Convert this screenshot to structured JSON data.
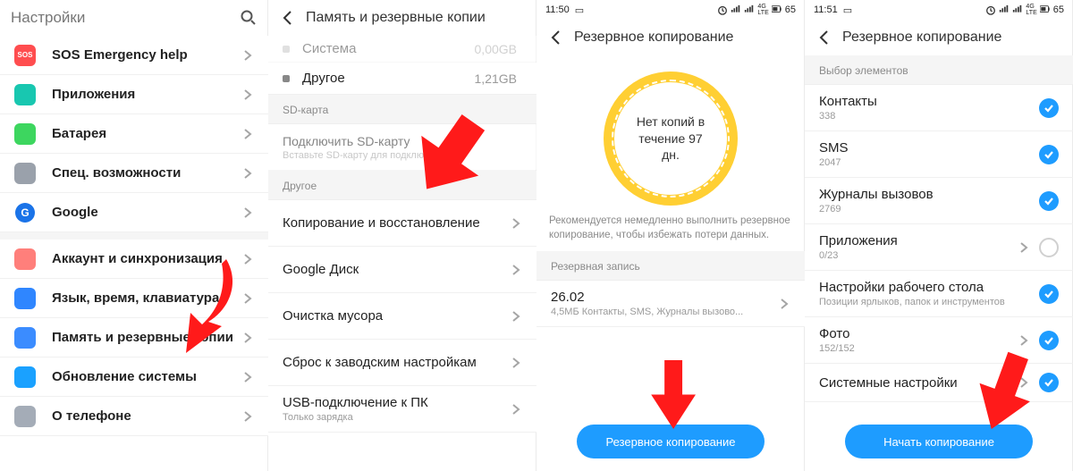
{
  "panel1": {
    "title": "Настройки",
    "items": [
      {
        "label": "SOS Emergency help"
      },
      {
        "label": "Приложения"
      },
      {
        "label": "Батарея"
      },
      {
        "label": "Спец. возможности"
      },
      {
        "label": "Google"
      },
      {
        "label": "Аккаунт и синхронизация"
      },
      {
        "label": "Язык, время, клавиатура"
      },
      {
        "label": "Память и резервные копии"
      },
      {
        "label": "Обновление системы"
      },
      {
        "label": "О телефоне"
      }
    ]
  },
  "panel2": {
    "title": "Память и резервные копии",
    "storage": {
      "system_label": "Система",
      "system_value": "0,00GB",
      "other_label": "Другое",
      "other_value": "1,21GB"
    },
    "sd_header": "SD-карта",
    "sd_connect": "Подключить SD-карту",
    "sd_connect_sub": "Вставьте SD-карту для подключения",
    "other_header": "Другое",
    "rows": [
      {
        "label": "Копирование и восстановление"
      },
      {
        "label": "Google Диск"
      },
      {
        "label": "Очистка мусора"
      },
      {
        "label": "Сброс к заводским настройкам"
      },
      {
        "label": "USB-подключение к ПК",
        "sub": "Только зарядка"
      }
    ]
  },
  "panel3": {
    "status_time": "11:50",
    "status_battery": "65",
    "title": "Резервное копирование",
    "circle_text": "Нет копий в течение 97 дн.",
    "recommend": "Рекомендуется немедленно выполнить резервное копирование, чтобы избежать потери данных.",
    "section_header": "Резервная запись",
    "entry_date": "26.02",
    "entry_sub": "4,5МБ   Контакты,  SMS,  Журналы вызово...",
    "cta": "Резервное копирование"
  },
  "panel4": {
    "status_time": "11:51",
    "status_battery": "65",
    "title": "Резервное копирование",
    "section_header": "Выбор элементов",
    "items": [
      {
        "title": "Контакты",
        "sub": "338",
        "chev": false,
        "checked": true
      },
      {
        "title": "SMS",
        "sub": "2047",
        "chev": false,
        "checked": true
      },
      {
        "title": "Журналы вызовов",
        "sub": "2769",
        "chev": false,
        "checked": true
      },
      {
        "title": "Приложения",
        "sub": "0/23",
        "chev": true,
        "checked": false
      },
      {
        "title": "Настройки рабочего стола",
        "sub": "Позиции ярлыков, папок и инструментов",
        "chev": false,
        "checked": true
      },
      {
        "title": "Фото",
        "sub": "152/152",
        "chev": true,
        "checked": true
      },
      {
        "title": "Системные настройки",
        "sub": "",
        "chev": true,
        "checked": true
      }
    ],
    "cta": "Начать копирование"
  }
}
